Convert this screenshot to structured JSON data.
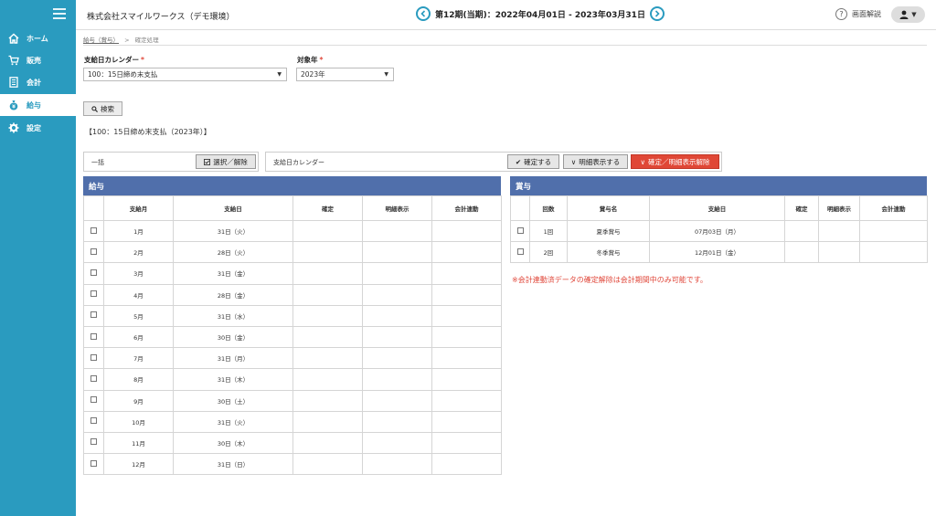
{
  "header": {
    "company": "株式会社スマイルワークス（デモ環境）",
    "period": "第12期(当期)：2022年04月01日 - 2023年03月31日",
    "help_label": "画面解説"
  },
  "sidebar": {
    "items": [
      {
        "label": "ホーム",
        "icon": "home-icon"
      },
      {
        "label": "販売",
        "icon": "cart-icon"
      },
      {
        "label": "会計",
        "icon": "ledger-icon"
      },
      {
        "label": "給与",
        "icon": "money-bag-icon"
      },
      {
        "label": "設定",
        "icon": "gear-icon"
      }
    ],
    "active_index": 3
  },
  "breadcrumb": {
    "link": "給与（賞与）",
    "separator": ">",
    "current": "確定処理"
  },
  "form": {
    "calendar_label": "支給日カレンダー",
    "calendar_value": "100：15日締め末支払",
    "year_label": "対象年",
    "year_value": "2023年",
    "search_label": "検索"
  },
  "condition_text": "【100：15日締め末支払（2023年）】",
  "bulk_bar": {
    "label": "一括",
    "button": "選択／解除"
  },
  "calendar_bar": {
    "label": "支給日カレンダー",
    "confirm": "確定する",
    "show_detail": "明細表示する",
    "release": "確定／明細表示解除"
  },
  "salary": {
    "title": "給与",
    "columns": [
      "支給月",
      "支給日",
      "確定",
      "明細表示",
      "会計連動"
    ],
    "rows": [
      [
        "1月",
        "31日（火）"
      ],
      [
        "2月",
        "28日（火）"
      ],
      [
        "3月",
        "31日（金）"
      ],
      [
        "4月",
        "28日（金）"
      ],
      [
        "5月",
        "31日（水）"
      ],
      [
        "6月",
        "30日（金）"
      ],
      [
        "7月",
        "31日（月）"
      ],
      [
        "8月",
        "31日（木）"
      ],
      [
        "9月",
        "30日（土）"
      ],
      [
        "10月",
        "31日（火）"
      ],
      [
        "11月",
        "30日（木）"
      ],
      [
        "12月",
        "31日（日）"
      ]
    ]
  },
  "bonus": {
    "title": "賞与",
    "columns": [
      "回数",
      "賞与名",
      "支給日",
      "確定",
      "明細表示",
      "会計連動"
    ],
    "rows": [
      [
        "1回",
        "夏季賞与",
        "07月03日（月）"
      ],
      [
        "2回",
        "冬季賞与",
        "12月01日（金）"
      ]
    ]
  },
  "note": "※会計連動済データの確定解除は会計期間中のみ可能です。",
  "colors": {
    "sidebar": "#2a9bbf",
    "panel_header": "#506fab",
    "danger": "#e04736"
  }
}
